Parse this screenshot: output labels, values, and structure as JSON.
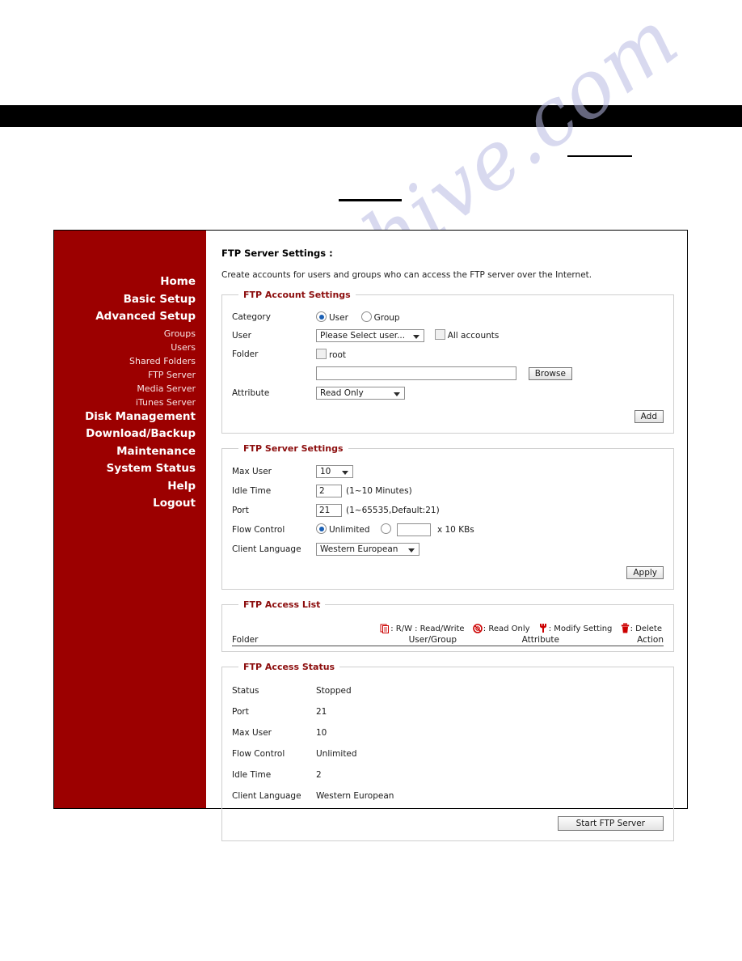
{
  "page": {
    "black_bar": "",
    "redaction_rules": [
      "",
      ""
    ],
    "watermark": "manualshive.com"
  },
  "sidebar": {
    "items": [
      {
        "label": "Home",
        "level": "top"
      },
      {
        "label": "Basic Setup",
        "level": "top"
      },
      {
        "label": "Advanced Setup",
        "level": "top"
      },
      {
        "label": "Groups",
        "level": "sub"
      },
      {
        "label": "Users",
        "level": "sub"
      },
      {
        "label": "Shared Folders",
        "level": "sub"
      },
      {
        "label": "FTP Server",
        "level": "sub"
      },
      {
        "label": "Media Server",
        "level": "sub"
      },
      {
        "label": "iTunes Server",
        "level": "sub"
      },
      {
        "label": "Disk Management",
        "level": "top"
      },
      {
        "label": "Download/Backup",
        "level": "top"
      },
      {
        "label": "Maintenance",
        "level": "top"
      },
      {
        "label": "System Status",
        "level": "top"
      },
      {
        "label": "Help",
        "level": "top"
      },
      {
        "label": "Logout",
        "level": "top"
      }
    ]
  },
  "main": {
    "title": "FTP Server Settings :",
    "description": "Create accounts for users and groups who can access the FTP server over the Internet.",
    "account_settings": {
      "legend": "FTP Account Settings",
      "category_label": "Category",
      "category_user": "User",
      "category_group": "Group",
      "category_selected": "User",
      "user_label": "User",
      "user_select_value": "Please Select user...",
      "all_accounts_label": "All accounts",
      "folder_label": "Folder",
      "root_label": "root",
      "folder_path_value": "",
      "browse_label": "Browse",
      "attribute_label": "Attribute",
      "attribute_value": "Read Only",
      "add_label": "Add"
    },
    "server_settings": {
      "legend": "FTP Server Settings",
      "max_user_label": "Max User",
      "max_user_value": "10",
      "idle_time_label": "Idle Time",
      "idle_time_value": "2",
      "idle_time_hint": "(1~10 Minutes)",
      "port_label": "Port",
      "port_value": "21",
      "port_hint": "(1~65535,Default:21)",
      "flow_control_label": "Flow Control",
      "flow_unlimited_label": "Unlimited",
      "flow_custom_value": "",
      "flow_unit": "x 10 KBs",
      "client_language_label": "Client Language",
      "client_language_value": "Western European",
      "apply_label": "Apply"
    },
    "access_list": {
      "legend": "FTP Access List",
      "legend_rw": ": R/W : Read/Write",
      "legend_ro": ": Read Only",
      "legend_modify": ": Modify Setting",
      "legend_delete": ": Delete",
      "columns": [
        "Folder",
        "User/Group",
        "Attribute",
        "Action"
      ],
      "rows": []
    },
    "access_status": {
      "legend": "FTP Access Status",
      "rows": [
        {
          "key": "Status",
          "value": "Stopped"
        },
        {
          "key": "Port",
          "value": "21"
        },
        {
          "key": "Max User",
          "value": "10"
        },
        {
          "key": "Flow Control",
          "value": "Unlimited"
        },
        {
          "key": "Idle Time",
          "value": "2"
        },
        {
          "key": "Client Language",
          "value": "Western European"
        }
      ],
      "start_label": "Start FTP Server"
    }
  },
  "colors": {
    "sidebar_red": "#9c0000",
    "legend_red": "#8c0d0d",
    "icon_red": "#cc0000",
    "radio_blue": "#1a5fb4",
    "watermark": "#b9bbe3"
  }
}
